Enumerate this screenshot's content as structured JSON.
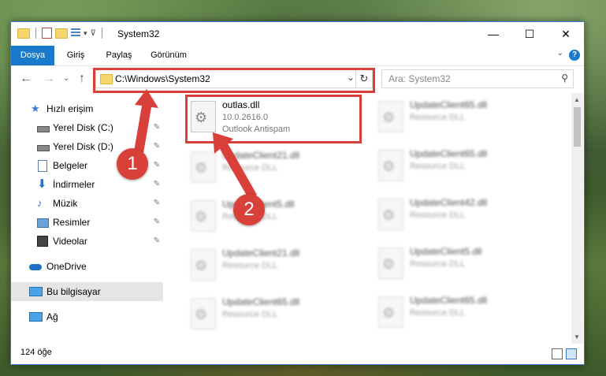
{
  "window": {
    "title": "System32",
    "controls": {
      "minimize": "—",
      "maximize": "☐",
      "close": "✕"
    }
  },
  "ribbon": {
    "tabs": [
      "Dosya",
      "Giriş",
      "Paylaş",
      "Görünüm"
    ],
    "help": "?",
    "collapse": "⌄"
  },
  "nav": {
    "back": "←",
    "forward": "→",
    "recent": "⌄",
    "up": "↑"
  },
  "address": {
    "path": "C:\\Windows\\System32",
    "dropdown": "⌄",
    "refresh": "↻"
  },
  "search": {
    "placeholder": "Ara: System32",
    "icon": "⚲"
  },
  "sidebar": {
    "items": [
      {
        "label": "Hızlı erişim",
        "icon": "star-icon"
      },
      {
        "label": "Yerel Disk (C:)",
        "icon": "drive-icon",
        "pinned": true
      },
      {
        "label": "Yerel Disk (D:)",
        "icon": "drive-icon",
        "pinned": true
      },
      {
        "label": "Belgeler",
        "icon": "documents-icon",
        "pinned": true
      },
      {
        "label": "İndirmeler",
        "icon": "download-icon",
        "pinned": true
      },
      {
        "label": "Müzik",
        "icon": "music-icon",
        "pinned": true
      },
      {
        "label": "Resimler",
        "icon": "pictures-icon",
        "pinned": true
      },
      {
        "label": "Videolar",
        "icon": "videos-icon",
        "pinned": true
      },
      {
        "label": "OneDrive",
        "icon": "cloud-icon"
      },
      {
        "label": "Bu bilgisayar",
        "icon": "computer-icon",
        "selected": true
      },
      {
        "label": "Ağ",
        "icon": "network-icon"
      }
    ],
    "pin_glyph": "📌"
  },
  "files": {
    "highlighted": {
      "name": "outlas.dll",
      "version": "10.0.2616.0",
      "description": "Outlook Antispam"
    },
    "left_column": [
      {
        "name": "UpdateClient21.dll",
        "type": "Resource DLL"
      },
      {
        "name": "UpdateClient5.dll",
        "type": "Resource DLL"
      },
      {
        "name": "UpdateClient21.dll",
        "type": "Resource DLL"
      },
      {
        "name": "UpdateClient65.dll",
        "type": "Resource DLL"
      }
    ],
    "right_column": [
      {
        "name": "UpdateClient65.dll",
        "type": "Resource DLL"
      },
      {
        "name": "UpdateClient65.dll",
        "type": "Resource DLL"
      },
      {
        "name": "UpdateClient42.dll",
        "type": "Resource DLL"
      },
      {
        "name": "UpdateClient5.dll",
        "type": "Resource DLL"
      },
      {
        "name": "UpdateClient65.dll",
        "type": "Resource DLL"
      }
    ]
  },
  "status": {
    "count": "124 öğe"
  },
  "annotations": {
    "badge1": "1",
    "badge2": "2",
    "color": "#d9403a"
  }
}
